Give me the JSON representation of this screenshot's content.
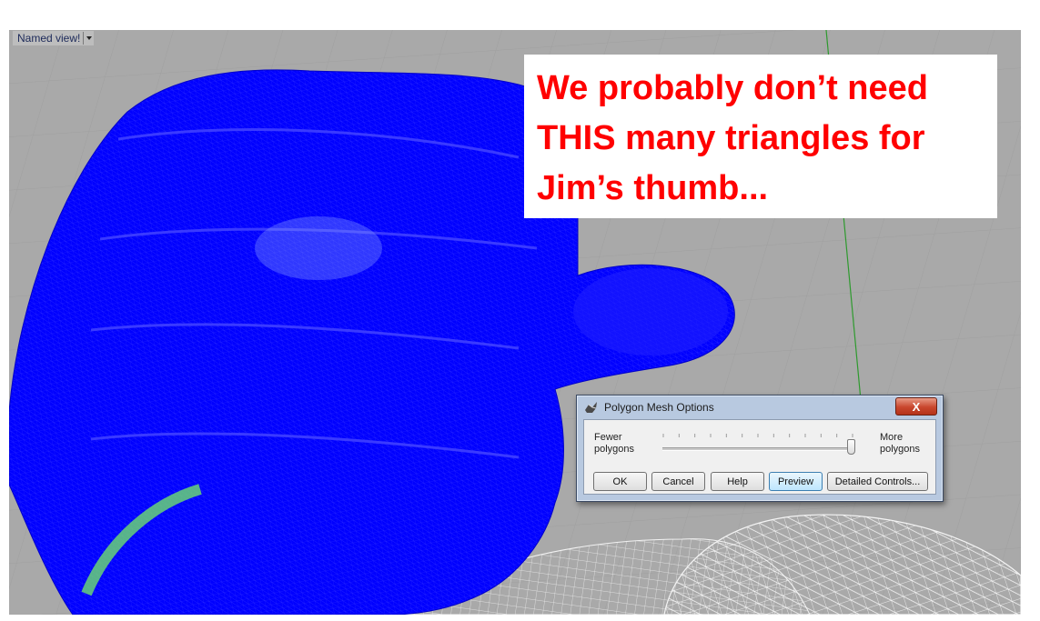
{
  "viewport": {
    "view_label": "Named view!",
    "view_menu_icon": "chevron-down-icon",
    "background_color": "#a9a9a9",
    "mesh_color": "#0000ff"
  },
  "callout": {
    "lines": [
      "We probably don’t need",
      "THIS many triangles for",
      "Jim’s thumb..."
    ],
    "color": "#ff0000"
  },
  "dialog": {
    "title": "Polygon Mesh Options",
    "icon": "rhino-app-icon",
    "close_label": "X",
    "slider": {
      "min_label_line1": "Fewer",
      "min_label_line2": "polygons",
      "max_label_line1": "More",
      "max_label_line2": "polygons",
      "value_fraction": 0.99
    },
    "buttons": {
      "ok": "OK",
      "cancel": "Cancel",
      "help": "Help",
      "preview": "Preview",
      "detailed": "Detailed Controls..."
    }
  }
}
